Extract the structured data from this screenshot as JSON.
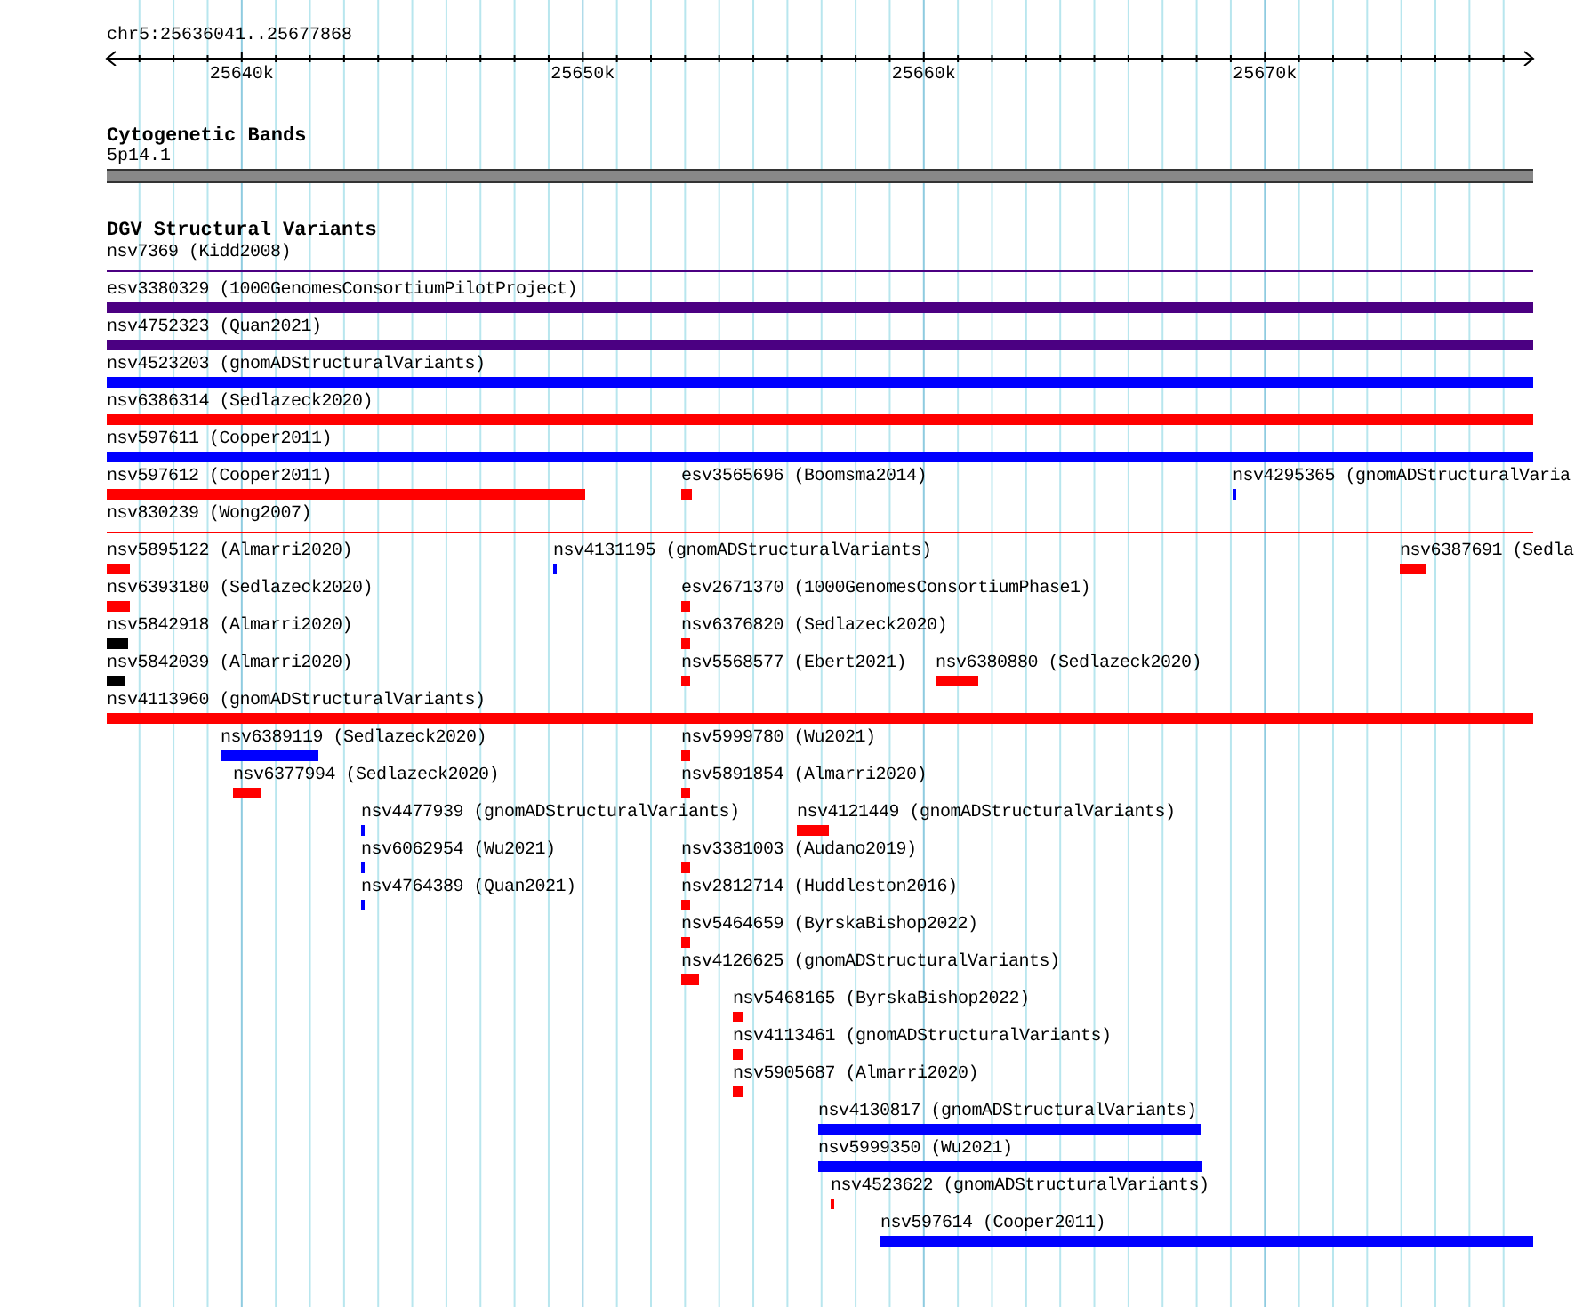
{
  "ruler": {
    "region": "chr5:25636041..25677868",
    "ticks": [
      "25640k",
      "25650k",
      "25660k",
      "25670k"
    ]
  },
  "cytogenetic_bands": {
    "title": "Cytogenetic Bands",
    "band": "5p14.1"
  },
  "dgv_track": {
    "title": "DGV Structural Variants",
    "variants": [
      {
        "label": "nsv7369 (Kidd2008)",
        "color": "#4b0082",
        "kind": "line"
      },
      {
        "label": "esv3380329 (1000GenomesConsortiumPilotProject)",
        "color": "#4b0082",
        "kind": "bar"
      },
      {
        "label": "nsv4752323 (Quan2021)",
        "color": "#4b0082",
        "kind": "bar"
      },
      {
        "label": "nsv4523203 (gnomADStructuralVariants)",
        "color": "#0000ff",
        "kind": "bar"
      },
      {
        "label": "nsv6386314 (Sedlazeck2020)",
        "color": "#ff0000",
        "kind": "bar"
      },
      {
        "label": "nsv597611 (Cooper2011)",
        "color": "#0000ff",
        "kind": "bar"
      },
      {
        "label": "nsv597612 (Cooper2011)",
        "color": "#ff0000",
        "kind": "bar"
      },
      {
        "label": "esv3565696 (Boomsma2014)",
        "color": "#ff0000",
        "kind": "bar"
      },
      {
        "label": "nsv4295365 (gnomADStructuralVaria",
        "color": "#0000ff",
        "kind": "bar"
      },
      {
        "label": "nsv830239 (Wong2007)",
        "color": "#ff0000",
        "kind": "line"
      },
      {
        "label": "nsv5895122 (Almarri2020)",
        "color": "#ff0000",
        "kind": "bar"
      },
      {
        "label": "nsv4131195 (gnomADStructuralVariants)",
        "color": "#0000ff",
        "kind": "bar"
      },
      {
        "label": "nsv6387691 (Sedla",
        "color": "#ff0000",
        "kind": "bar"
      },
      {
        "label": "nsv6393180 (Sedlazeck2020)",
        "color": "#ff0000",
        "kind": "bar"
      },
      {
        "label": "esv2671370 (1000GenomesConsortiumPhase1)",
        "color": "#ff0000",
        "kind": "bar"
      },
      {
        "label": "nsv5842918 (Almarri2020)",
        "color": "#000000",
        "kind": "bar"
      },
      {
        "label": "nsv6376820 (Sedlazeck2020)",
        "color": "#ff0000",
        "kind": "bar"
      },
      {
        "label": "nsv5842039 (Almarri2020)",
        "color": "#000000",
        "kind": "bar"
      },
      {
        "label": "nsv5568577 (Ebert2021)",
        "color": "#ff0000",
        "kind": "bar"
      },
      {
        "label": "nsv6380880 (Sedlazeck2020)",
        "color": "#ff0000",
        "kind": "bar"
      },
      {
        "label": "nsv4113960 (gnomADStructuralVariants)",
        "color": "#ff0000",
        "kind": "bar"
      },
      {
        "label": "nsv6389119 (Sedlazeck2020)",
        "color": "#0000ff",
        "kind": "bar"
      },
      {
        "label": "nsv5999780 (Wu2021)",
        "color": "#ff0000",
        "kind": "bar"
      },
      {
        "label": "nsv6377994 (Sedlazeck2020)",
        "color": "#ff0000",
        "kind": "bar"
      },
      {
        "label": "nsv5891854 (Almarri2020)",
        "color": "#ff0000",
        "kind": "bar"
      },
      {
        "label": "nsv4477939 (gnomADStructuralVariants)",
        "color": "#0000ff",
        "kind": "bar"
      },
      {
        "label": "nsv4121449 (gnomADStructuralVariants)",
        "color": "#ff0000",
        "kind": "bar"
      },
      {
        "label": "nsv6062954 (Wu2021)",
        "color": "#0000ff",
        "kind": "bar"
      },
      {
        "label": "nsv3381003 (Audano2019)",
        "color": "#ff0000",
        "kind": "bar"
      },
      {
        "label": "nsv4764389 (Quan2021)",
        "color": "#0000ff",
        "kind": "bar"
      },
      {
        "label": "nsv2812714 (Huddleston2016)",
        "color": "#ff0000",
        "kind": "bar"
      },
      {
        "label": "nsv5464659 (ByrskaBishop2022)",
        "color": "#ff0000",
        "kind": "bar"
      },
      {
        "label": "nsv4126625 (gnomADStructuralVariants)",
        "color": "#ff0000",
        "kind": "bar"
      },
      {
        "label": "nsv5468165 (ByrskaBishop2022)",
        "color": "#ff0000",
        "kind": "bar"
      },
      {
        "label": "nsv4113461 (gnomADStructuralVariants)",
        "color": "#ff0000",
        "kind": "bar"
      },
      {
        "label": "nsv5905687 (Almarri2020)",
        "color": "#ff0000",
        "kind": "bar"
      },
      {
        "label": "nsv4130817 (gnomADStructuralVariants)",
        "color": "#0000ff",
        "kind": "bar"
      },
      {
        "label": "nsv5999350 (Wu2021)",
        "color": "#0000ff",
        "kind": "bar"
      },
      {
        "label": "nsv4523622 (gnomADStructuralVariants)",
        "color": "#ff0000",
        "kind": "bar"
      },
      {
        "label": "nsv597614 (Cooper2011)",
        "color": "#0000ff",
        "kind": "bar"
      }
    ]
  }
}
